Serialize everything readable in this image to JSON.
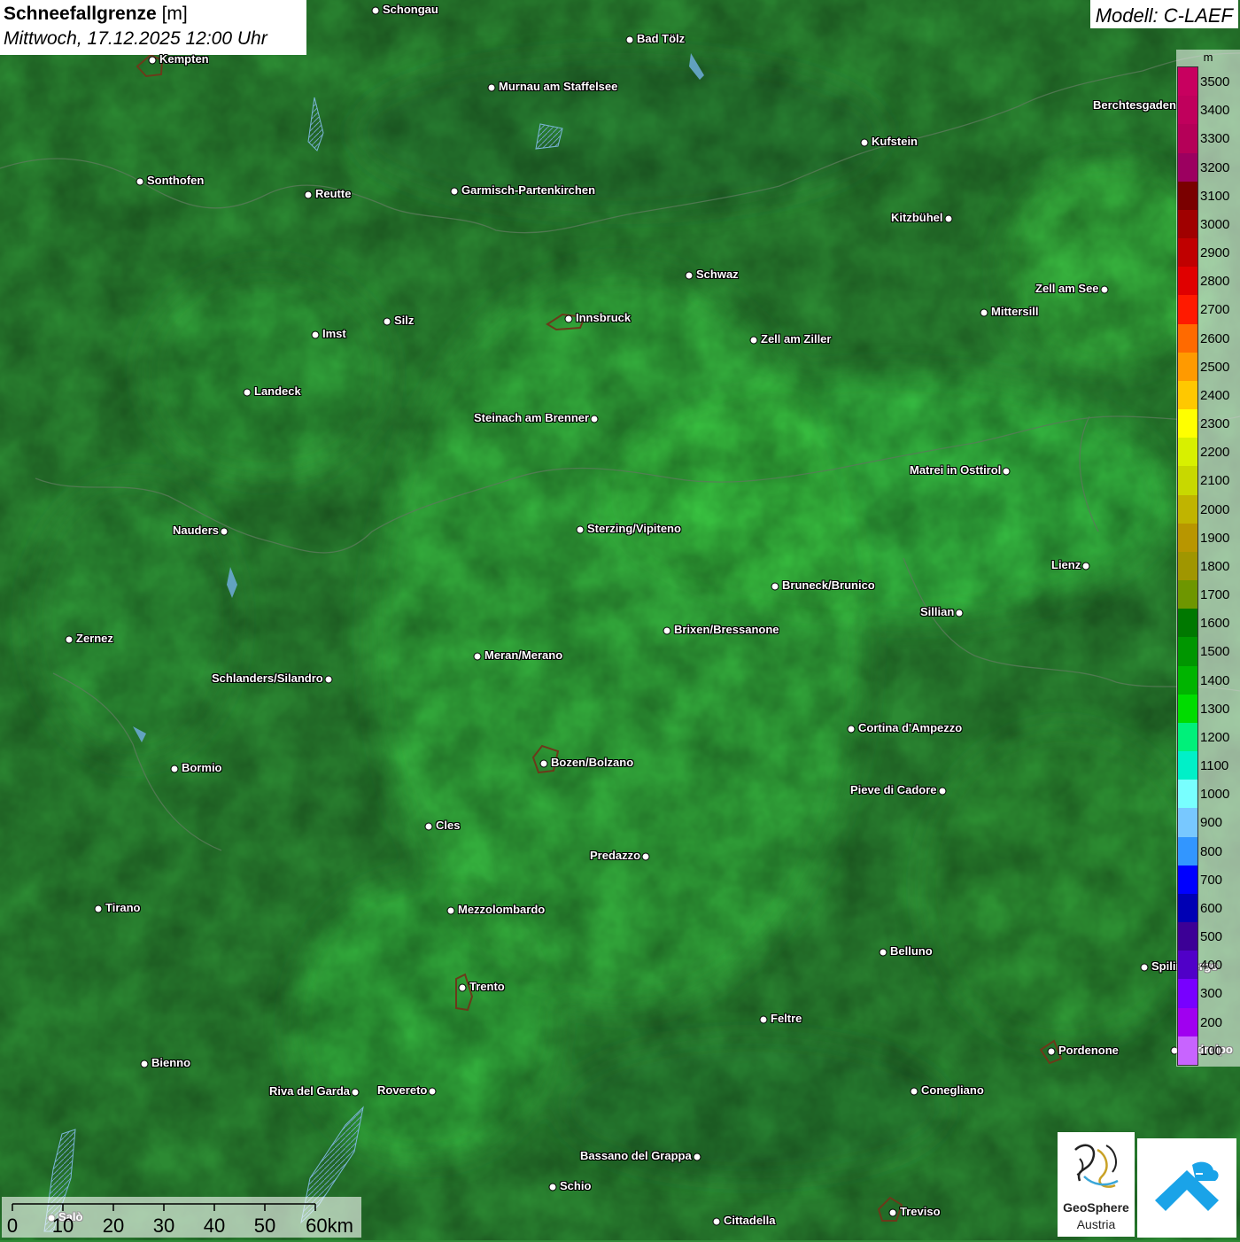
{
  "header": {
    "title_bold": "Schneefallgrenze",
    "title_unit": " [m]",
    "subtitle": "Mittwoch, 17.12.2025 12:00 Uhr"
  },
  "model_label": "Modell: C-LAEF",
  "legend": {
    "unit": "m",
    "levels": [
      {
        "label": "3500",
        "color": "#c8005f"
      },
      {
        "label": "3400",
        "color": "#c0005c"
      },
      {
        "label": "3300",
        "color": "#b50058"
      },
      {
        "label": "3200",
        "color": "#9c0060"
      },
      {
        "label": "3100",
        "color": "#7a0000"
      },
      {
        "label": "3000",
        "color": "#a00000"
      },
      {
        "label": "2900",
        "color": "#c00000"
      },
      {
        "label": "2800",
        "color": "#e00000"
      },
      {
        "label": "2700",
        "color": "#ff1a00"
      },
      {
        "label": "2600",
        "color": "#ff6a00"
      },
      {
        "label": "2500",
        "color": "#ff9a00"
      },
      {
        "label": "2400",
        "color": "#ffc800"
      },
      {
        "label": "2300",
        "color": "#ffff00"
      },
      {
        "label": "2200",
        "color": "#d8f000"
      },
      {
        "label": "2100",
        "color": "#c8d800"
      },
      {
        "label": "2000",
        "color": "#c0b400"
      },
      {
        "label": "1900",
        "color": "#b89600"
      },
      {
        "label": "1800",
        "color": "#a09600"
      },
      {
        "label": "1700",
        "color": "#6e9600"
      },
      {
        "label": "1600",
        "color": "#007800"
      },
      {
        "label": "1500",
        "color": "#009600"
      },
      {
        "label": "1400",
        "color": "#00b400"
      },
      {
        "label": "1300",
        "color": "#00dc00"
      },
      {
        "label": "1200",
        "color": "#00f07a"
      },
      {
        "label": "1100",
        "color": "#00f0c8"
      },
      {
        "label": "1000",
        "color": "#78ffff"
      },
      {
        "label": "900",
        "color": "#78c8ff"
      },
      {
        "label": "800",
        "color": "#3296ff"
      },
      {
        "label": "700",
        "color": "#0000ff"
      },
      {
        "label": "600",
        "color": "#0000b4"
      },
      {
        "label": "500",
        "color": "#3c0096"
      },
      {
        "label": "400",
        "color": "#5000c8"
      },
      {
        "label": "300",
        "color": "#7800ff"
      },
      {
        "label": "200",
        "color": "#a000f0"
      },
      {
        "label": "100",
        "color": "#c864ff"
      }
    ]
  },
  "cities": [
    {
      "name": "Schongau",
      "side": "right"
    },
    {
      "name": "Bad Tölz",
      "side": "right"
    },
    {
      "name": "Kempten",
      "side": "right"
    },
    {
      "name": "Murnau am Staffelsee",
      "side": "right"
    },
    {
      "name": "Berchtesgaden",
      "side": "left"
    },
    {
      "name": "Kufstein",
      "side": "right"
    },
    {
      "name": "Sonthofen",
      "side": "right"
    },
    {
      "name": "Reutte",
      "side": "right"
    },
    {
      "name": "Garmisch-Partenkirchen",
      "side": "right"
    },
    {
      "name": "Kitzbühel",
      "side": "left"
    },
    {
      "name": "Schwaz",
      "side": "right"
    },
    {
      "name": "Zell am See",
      "side": "left"
    },
    {
      "name": "Mittersill",
      "side": "right"
    },
    {
      "name": "Innsbruck",
      "side": "right"
    },
    {
      "name": "Imst",
      "side": "right"
    },
    {
      "name": "Silz",
      "side": "right"
    },
    {
      "name": "Zell am Ziller",
      "side": "right"
    },
    {
      "name": "Landeck",
      "side": "right"
    },
    {
      "name": "Steinach am Brenner",
      "side": "left"
    },
    {
      "name": "Matrei in Osttirol",
      "side": "left"
    },
    {
      "name": "Nauders",
      "side": "left"
    },
    {
      "name": "Sterzing/Vipiteno",
      "side": "right"
    },
    {
      "name": "Lienz",
      "side": "left"
    },
    {
      "name": "Bruneck/Brunico",
      "side": "right"
    },
    {
      "name": "Sillian",
      "side": "left"
    },
    {
      "name": "Zernez",
      "side": "right"
    },
    {
      "name": "Brixen/Bressanone",
      "side": "right"
    },
    {
      "name": "Meran/Merano",
      "side": "right"
    },
    {
      "name": "Schlanders/Silandro",
      "side": "left"
    },
    {
      "name": "Cortina d'Ampezzo",
      "side": "right"
    },
    {
      "name": "Bozen/Bolzano",
      "side": "right"
    },
    {
      "name": "Bormio",
      "side": "right"
    },
    {
      "name": "Pieve di Cadore",
      "side": "left"
    },
    {
      "name": "Cles",
      "side": "right"
    },
    {
      "name": "Predazzo",
      "side": "left"
    },
    {
      "name": "Tirano",
      "side": "right"
    },
    {
      "name": "Mezzolombardo",
      "side": "right"
    },
    {
      "name": "Belluno",
      "side": "right"
    },
    {
      "name": "Spilimbergo",
      "side": "right"
    },
    {
      "name": "Trento",
      "side": "right"
    },
    {
      "name": "Feltre",
      "side": "right"
    },
    {
      "name": "Pordenone",
      "side": "right"
    },
    {
      "name": "Codroipo",
      "side": "right"
    },
    {
      "name": "Bienno",
      "side": "right"
    },
    {
      "name": "Riva del Garda",
      "side": "left"
    },
    {
      "name": "Rovereto",
      "side": "left"
    },
    {
      "name": "Conegliano",
      "side": "right"
    },
    {
      "name": "Bassano del Grappa",
      "side": "left"
    },
    {
      "name": "Schio",
      "side": "right"
    },
    {
      "name": "Treviso",
      "side": "right"
    },
    {
      "name": "Cittadella",
      "side": "right"
    },
    {
      "name": "Salò",
      "side": "right"
    }
  ],
  "scale_bar": {
    "ticks": [
      "0",
      "10",
      "20",
      "30",
      "40",
      "50",
      "60km"
    ]
  },
  "logos": {
    "geosphere_name": "GeoSphere",
    "geosphere_sub": "Austria",
    "app_icon": "uwz-app-icon"
  }
}
